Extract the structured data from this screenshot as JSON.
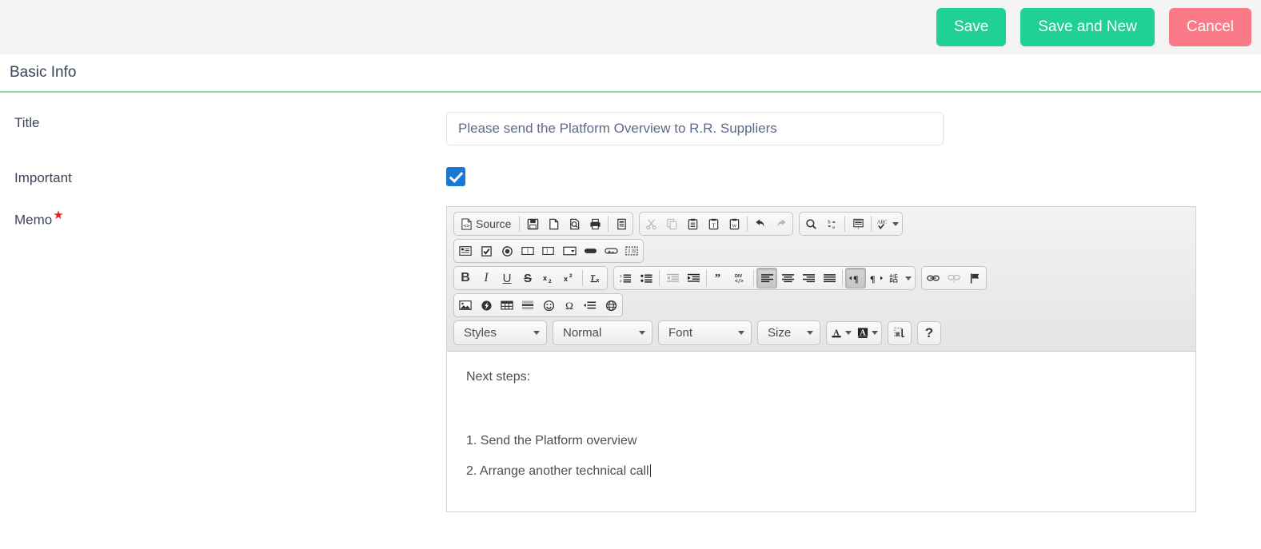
{
  "topbar": {
    "buttons": [
      {
        "label": "Save",
        "name": "save-button",
        "color": "#20d094"
      },
      {
        "label": "Save and New",
        "name": "save-and-new-button",
        "color": "#20d094"
      },
      {
        "label": "Cancel",
        "name": "cancel-button",
        "color": "#fa7a88"
      }
    ]
  },
  "card": {
    "header_title": "Basic Info",
    "header_underline_color": "#8ce196"
  },
  "fields": {
    "title": {
      "label": "Title",
      "value": "Please send the Platform Overview to R.R. Suppliers",
      "placeholder": ""
    },
    "important": {
      "label": "Important",
      "checked": true,
      "check_color": "#1878d4"
    },
    "memo": {
      "label": "Memo",
      "required_marker": "★",
      "required_color": "#f01a24"
    }
  },
  "editor": {
    "toolbar_rows": [
      {
        "groups": [
          {
            "name": "document-group",
            "items": [
              {
                "name": "source-button",
                "label": "Source",
                "icon": "source-icon",
                "state": "normal"
              },
              {
                "name": "separator",
                "icon": "separator",
                "state": "sep"
              },
              {
                "name": "save-icon-button",
                "icon": "floppy-disk-icon",
                "state": "normal"
              },
              {
                "name": "new-page-button",
                "icon": "new-page-icon",
                "state": "normal"
              },
              {
                "name": "preview-button",
                "icon": "preview-magnifier-icon",
                "state": "normal"
              },
              {
                "name": "print-button",
                "icon": "printer-icon",
                "state": "normal"
              },
              {
                "name": "separator",
                "icon": "separator",
                "state": "sep"
              },
              {
                "name": "templates-button",
                "icon": "templates-document-icon",
                "state": "normal"
              }
            ]
          },
          {
            "name": "clipboard-group",
            "items": [
              {
                "name": "cut-button",
                "icon": "scissors-icon",
                "state": "disabled"
              },
              {
                "name": "copy-button",
                "icon": "copy-pages-icon",
                "state": "disabled"
              },
              {
                "name": "paste-button",
                "icon": "clipboard-icon",
                "state": "normal"
              },
              {
                "name": "paste-text-button",
                "icon": "clipboard-text-icon",
                "state": "normal"
              },
              {
                "name": "paste-word-button",
                "icon": "clipboard-word-icon",
                "state": "normal"
              },
              {
                "name": "separator",
                "icon": "separator",
                "state": "sep"
              },
              {
                "name": "undo-button",
                "icon": "undo-arrow-icon",
                "state": "normal"
              },
              {
                "name": "redo-button",
                "icon": "redo-arrow-icon",
                "state": "disabled"
              }
            ]
          },
          {
            "name": "editing-group",
            "items": [
              {
                "name": "find-button",
                "icon": "magnifier-icon",
                "state": "normal"
              },
              {
                "name": "replace-button",
                "icon": "replace-ba-icon",
                "state": "normal"
              },
              {
                "name": "separator",
                "icon": "separator",
                "state": "sep"
              },
              {
                "name": "select-all-button",
                "icon": "select-all-icon",
                "state": "normal"
              },
              {
                "name": "separator",
                "icon": "separator",
                "state": "sep"
              },
              {
                "name": "spellcheck-button",
                "icon": "spellcheck-abc-icon",
                "state": "dropdown"
              }
            ]
          }
        ]
      },
      {
        "groups": [
          {
            "name": "forms-group",
            "items": [
              {
                "name": "form-button",
                "icon": "form-icon",
                "state": "normal"
              },
              {
                "name": "checkbox-button",
                "icon": "checkbox-icon",
                "state": "normal"
              },
              {
                "name": "radio-button",
                "icon": "radio-button-icon",
                "state": "normal"
              },
              {
                "name": "text-field-button",
                "icon": "text-field-icon",
                "state": "normal"
              },
              {
                "name": "textarea-button",
                "icon": "textarea-icon",
                "state": "normal"
              },
              {
                "name": "select-field-button",
                "icon": "select-field-icon",
                "state": "normal"
              },
              {
                "name": "button-field-button",
                "icon": "button-field-icon",
                "state": "normal"
              },
              {
                "name": "image-button-field",
                "icon": "image-button-icon",
                "state": "normal"
              },
              {
                "name": "hidden-field-button",
                "icon": "hidden-field-icon",
                "state": "normal"
              }
            ]
          }
        ]
      },
      {
        "groups": [
          {
            "name": "basic-styles-group",
            "items": [
              {
                "name": "bold-button",
                "icon": "bold-icon",
                "label": "B",
                "state": "normal"
              },
              {
                "name": "italic-button",
                "icon": "italic-icon",
                "label": "I",
                "state": "normal"
              },
              {
                "name": "underline-button",
                "icon": "underline-icon",
                "label": "U",
                "state": "normal"
              },
              {
                "name": "strike-button",
                "icon": "strikethrough-icon",
                "label": "S",
                "state": "normal"
              },
              {
                "name": "subscript-button",
                "icon": "subscript-icon",
                "state": "normal"
              },
              {
                "name": "superscript-button",
                "icon": "superscript-icon",
                "state": "normal"
              },
              {
                "name": "separator",
                "icon": "separator",
                "state": "sep"
              },
              {
                "name": "remove-format-button",
                "icon": "remove-format-icon",
                "state": "normal"
              }
            ]
          },
          {
            "name": "paragraph-group",
            "items": [
              {
                "name": "numbered-list-button",
                "icon": "numbered-list-icon",
                "state": "normal"
              },
              {
                "name": "bulleted-list-button",
                "icon": "bulleted-list-icon",
                "state": "normal"
              },
              {
                "name": "separator",
                "icon": "separator",
                "state": "sep"
              },
              {
                "name": "outdent-button",
                "icon": "outdent-icon",
                "state": "disabled"
              },
              {
                "name": "indent-button",
                "icon": "indent-icon",
                "state": "normal"
              },
              {
                "name": "separator",
                "icon": "separator",
                "state": "sep"
              },
              {
                "name": "blockquote-button",
                "icon": "blockquote-icon",
                "state": "normal"
              },
              {
                "name": "create-div-button",
                "icon": "create-div-icon",
                "state": "normal"
              },
              {
                "name": "separator",
                "icon": "separator",
                "state": "sep"
              },
              {
                "name": "align-left-button",
                "icon": "align-left-icon",
                "state": "active"
              },
              {
                "name": "align-center-button",
                "icon": "align-center-icon",
                "state": "normal"
              },
              {
                "name": "align-right-button",
                "icon": "align-right-icon",
                "state": "normal"
              },
              {
                "name": "align-justify-button",
                "icon": "align-justify-icon",
                "state": "normal"
              },
              {
                "name": "separator",
                "icon": "separator",
                "state": "sep"
              },
              {
                "name": "ltr-button",
                "icon": "direction-ltr-icon",
                "state": "active"
              },
              {
                "name": "rtl-button",
                "icon": "direction-rtl-icon",
                "state": "normal"
              },
              {
                "name": "language-button",
                "icon": "language-icon",
                "state": "dropdown"
              }
            ]
          },
          {
            "name": "links-group",
            "items": [
              {
                "name": "link-button",
                "icon": "link-icon",
                "state": "normal"
              },
              {
                "name": "unlink-button",
                "icon": "unlink-icon",
                "state": "disabled"
              },
              {
                "name": "anchor-button",
                "icon": "anchor-flag-icon",
                "state": "normal"
              }
            ]
          }
        ]
      },
      {
        "groups": [
          {
            "name": "insert-group",
            "items": [
              {
                "name": "image-button",
                "icon": "image-icon",
                "state": "normal"
              },
              {
                "name": "flash-button",
                "icon": "flash-icon",
                "state": "normal"
              },
              {
                "name": "table-button",
                "icon": "table-icon",
                "state": "normal"
              },
              {
                "name": "horizontal-rule-button",
                "icon": "horizontal-rule-icon",
                "state": "normal"
              },
              {
                "name": "smiley-button",
                "icon": "smiley-icon",
                "state": "normal"
              },
              {
                "name": "special-char-button",
                "icon": "omega-icon",
                "state": "normal"
              },
              {
                "name": "page-break-button",
                "icon": "page-break-icon",
                "state": "normal"
              },
              {
                "name": "iframe-button",
                "icon": "globe-iframe-icon",
                "state": "normal"
              }
            ]
          }
        ]
      },
      {
        "combos": [
          {
            "name": "styles-combo",
            "label": "Styles"
          },
          {
            "name": "paragraph-format-combo",
            "label": "Normal"
          },
          {
            "name": "font-combo",
            "label": "Font"
          },
          {
            "name": "font-size-combo",
            "label": "Size"
          }
        ],
        "groups": [
          {
            "name": "colors-group",
            "items": [
              {
                "name": "text-color-button",
                "icon": "text-color-icon",
                "state": "dropdown"
              },
              {
                "name": "background-color-button",
                "icon": "background-color-icon",
                "state": "dropdown"
              }
            ]
          },
          {
            "name": "tools-group",
            "items": [
              {
                "name": "maximize-button",
                "icon": "maximize-icon",
                "state": "normal"
              }
            ]
          },
          {
            "name": "about-group",
            "items": [
              {
                "name": "about-button",
                "icon": "question-mark-icon",
                "label": "?",
                "state": "normal"
              }
            ]
          }
        ]
      }
    ],
    "content": {
      "heading": "Next steps:",
      "items": [
        "1. Send the Platform overview",
        "2. Arrange another technical call"
      ]
    }
  }
}
